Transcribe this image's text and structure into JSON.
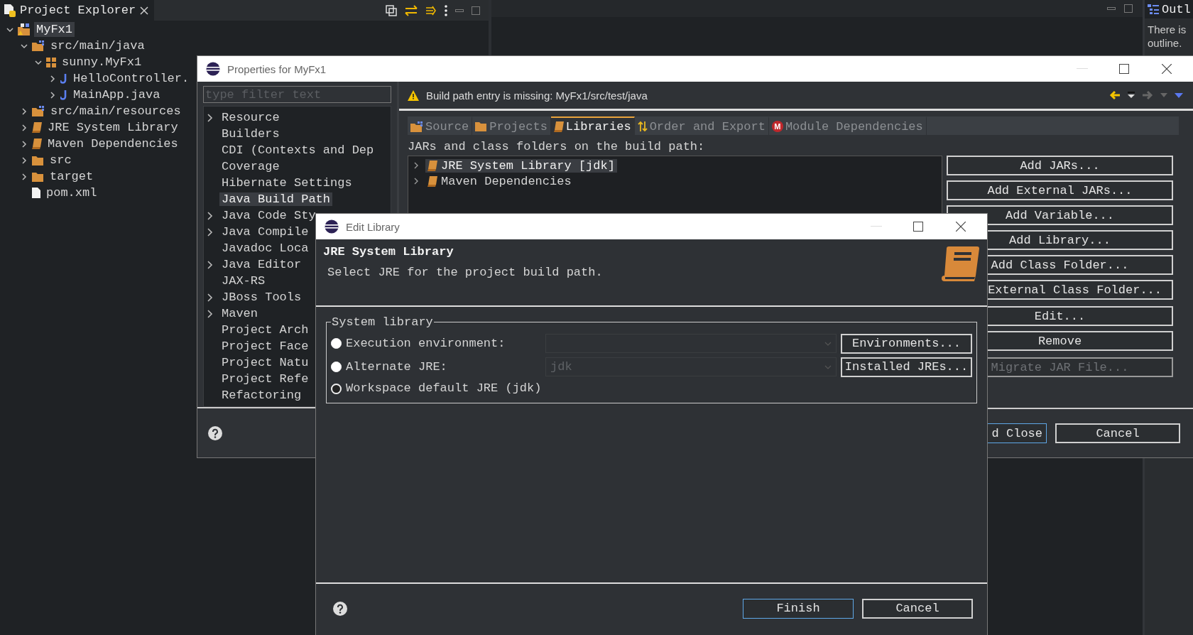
{
  "workbench": {
    "explorer": {
      "title": "Project Explorer",
      "tree": [
        {
          "label": "MyFx1",
          "kind": "project",
          "expanded": true,
          "selected": true,
          "children": [
            {
              "label": "src/main/java",
              "kind": "source",
              "expanded": true,
              "selected": false,
              "children": [
                {
                  "label": "sunny.MyFx1",
                  "kind": "package",
                  "expanded": true,
                  "selected": false,
                  "children": [
                    {
                      "label": "HelloController.",
                      "kind": "java",
                      "expanded": false,
                      "selected": false
                    },
                    {
                      "label": "MainApp.java",
                      "kind": "java",
                      "expanded": false,
                      "selected": false
                    }
                  ]
                }
              ]
            },
            {
              "label": "src/main/resources",
              "kind": "source",
              "expanded": false,
              "selected": false
            },
            {
              "label": "JRE System Library",
              "kind": "library",
              "expanded": false,
              "selected": false
            },
            {
              "label": "Maven Dependencies",
              "kind": "library",
              "expanded": false,
              "selected": false
            },
            {
              "label": "src",
              "kind": "folder",
              "expanded": false,
              "selected": false
            },
            {
              "label": "target",
              "kind": "folder",
              "expanded": false,
              "selected": false
            },
            {
              "label": "pom.xml",
              "kind": "xml",
              "selected": false
            }
          ]
        }
      ]
    },
    "outline": {
      "title": "Outl",
      "message_lines": [
        "There is",
        "outline."
      ]
    }
  },
  "properties_dialog": {
    "title": "Properties for MyFx1",
    "filter": {
      "placeholder": "type filter text"
    },
    "pages": [
      {
        "label": "Resource",
        "expandable": true,
        "selected": false
      },
      {
        "label": "Builders",
        "expandable": false,
        "selected": false
      },
      {
        "label": "CDI (Contexts and Dep",
        "expandable": false,
        "selected": false
      },
      {
        "label": "Coverage",
        "expandable": false,
        "selected": false
      },
      {
        "label": "Hibernate Settings",
        "expandable": false,
        "selected": false
      },
      {
        "label": "Java Build Path",
        "expandable": false,
        "selected": true
      },
      {
        "label": "Java Code Sty",
        "expandable": true,
        "selected": false
      },
      {
        "label": "Java Compile",
        "expandable": true,
        "selected": false
      },
      {
        "label": "Javadoc Loca",
        "expandable": false,
        "selected": false
      },
      {
        "label": "Java Editor",
        "expandable": true,
        "selected": false
      },
      {
        "label": "JAX-RS",
        "expandable": false,
        "selected": false
      },
      {
        "label": "JBoss Tools",
        "expandable": true,
        "selected": false
      },
      {
        "label": "Maven",
        "expandable": true,
        "selected": false
      },
      {
        "label": "Project Arch",
        "expandable": false,
        "selected": false
      },
      {
        "label": "Project Face",
        "expandable": false,
        "selected": false
      },
      {
        "label": "Project Natu",
        "expandable": false,
        "selected": false
      },
      {
        "label": "Project Refe",
        "expandable": false,
        "selected": false
      },
      {
        "label": "Refactoring",
        "expandable": false,
        "selected": false
      }
    ],
    "message": "Build path entry is missing: MyFx1/src/test/java",
    "tabs": [
      {
        "label": "Source",
        "kind": "source",
        "selected": false
      },
      {
        "label": "Projects",
        "kind": "folder",
        "selected": false
      },
      {
        "label": "Libraries",
        "kind": "library",
        "selected": true
      },
      {
        "label": "Order and Export",
        "kind": "order",
        "selected": false
      },
      {
        "label": "Module Dependencies",
        "kind": "module",
        "badge": "M",
        "selected": false
      }
    ],
    "list_label": "JARs and class folders on the build path:",
    "entries": [
      {
        "label": "JRE System Library [jdk]",
        "selected": true
      },
      {
        "label": "Maven Dependencies",
        "selected": false
      }
    ],
    "side_button_groups": [
      [
        {
          "label": "Add JARs...",
          "disabled": false,
          "cut_left": false
        },
        {
          "label": "Add External JARs...",
          "disabled": false,
          "cut_left": false
        },
        {
          "label": "Add Variable...",
          "disabled": false,
          "cut_left": false
        },
        {
          "label": "Add Library...",
          "disabled": false,
          "cut_left": false
        },
        {
          "label": "Add Class Folder...",
          "disabled": false,
          "cut_left": false
        },
        {
          "label": "External Class Folder...",
          "disabled": false,
          "cut_left": true
        }
      ],
      [
        {
          "label": "Edit...",
          "disabled": false,
          "cut_left": false
        },
        {
          "label": "Remove",
          "disabled": false,
          "cut_left": false
        }
      ],
      [
        {
          "label": "Migrate JAR File...",
          "disabled": true,
          "cut_left": false
        }
      ]
    ],
    "footer_buttons": [
      {
        "label": "d Close",
        "focused": true,
        "cut_left": true
      },
      {
        "label": "Cancel",
        "focused": false,
        "cut_left": false
      }
    ]
  },
  "edit_library_dialog": {
    "title": "Edit Library",
    "heading": "JRE System Library",
    "description": "Select JRE for the project build path.",
    "group": {
      "title": "System library",
      "options": [
        {
          "label": "Execution environment:",
          "selected": false,
          "combo": {
            "disabled": true
          },
          "button": "Environments..."
        },
        {
          "label": "Alternate JRE:",
          "selected": false,
          "combo": {
            "value": "jdk",
            "disabled": true
          },
          "button": "Installed JREs..."
        },
        {
          "label": "Workspace default JRE (jdk)",
          "selected": true
        }
      ]
    },
    "footer_buttons": [
      {
        "label": "Finish",
        "focused": true
      },
      {
        "label": "Cancel",
        "focused": false
      }
    ]
  }
}
